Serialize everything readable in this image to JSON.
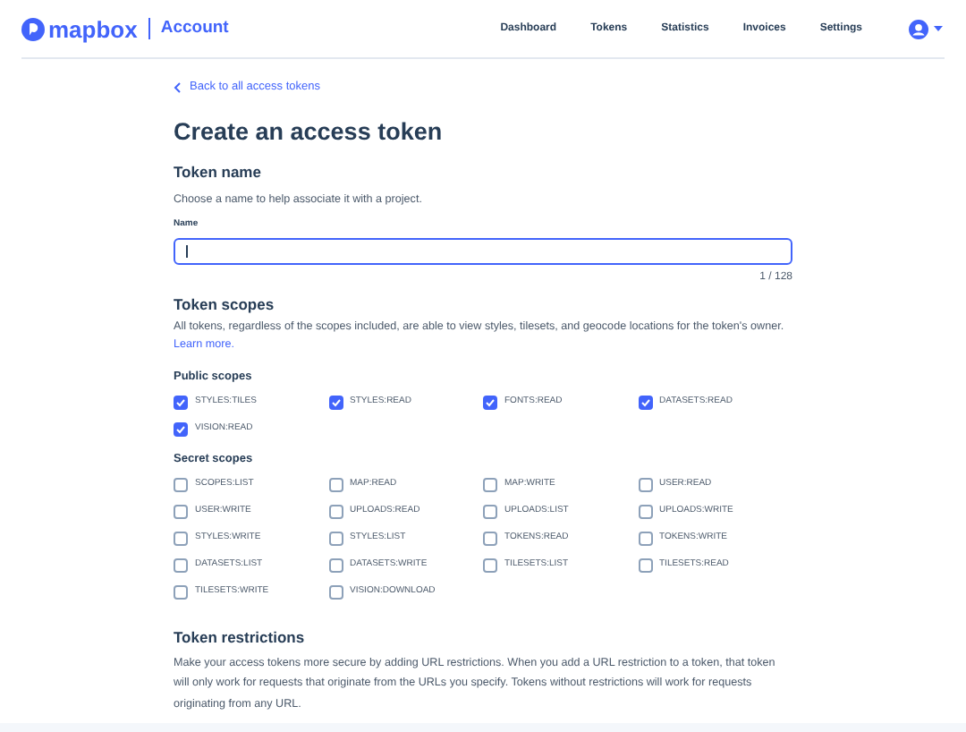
{
  "header": {
    "brand": "mapbox",
    "section": "Account",
    "nav": [
      "Dashboard",
      "Tokens",
      "Statistics",
      "Invoices",
      "Settings"
    ]
  },
  "back_link": "Back to all access tokens",
  "title": "Create an access token",
  "token_name": {
    "heading": "Token name",
    "description": "Choose a name to help associate it with a project.",
    "field_label": "Name",
    "counter": "1 / 128"
  },
  "token_scopes": {
    "heading": "Token scopes",
    "description": "All tokens, regardless of the scopes included, are able to view styles, tilesets, and geocode locations for the token's owner.",
    "link": "Learn more.",
    "groups": [
      {
        "heading": "Public scopes",
        "scopes": [
          {
            "label": "STYLES:TILES",
            "checked": true
          },
          {
            "label": "STYLES:READ",
            "checked": true
          },
          {
            "label": "FONTS:READ",
            "checked": true
          },
          {
            "label": "DATASETS:READ",
            "checked": true
          },
          {
            "label": "VISION:READ",
            "checked": true
          }
        ]
      },
      {
        "heading": "Secret scopes",
        "scopes": [
          {
            "label": "SCOPES:LIST",
            "checked": false
          },
          {
            "label": "MAP:READ",
            "checked": false
          },
          {
            "label": "MAP:WRITE",
            "checked": false
          },
          {
            "label": "USER:READ",
            "checked": false
          },
          {
            "label": "USER:WRITE",
            "checked": false
          },
          {
            "label": "UPLOADS:READ",
            "checked": false
          },
          {
            "label": "UPLOADS:LIST",
            "checked": false
          },
          {
            "label": "UPLOADS:WRITE",
            "checked": false
          },
          {
            "label": "STYLES:WRITE",
            "checked": false
          },
          {
            "label": "STYLES:LIST",
            "checked": false
          },
          {
            "label": "TOKENS:READ",
            "checked": false
          },
          {
            "label": "TOKENS:WRITE",
            "checked": false
          },
          {
            "label": "DATASETS:LIST",
            "checked": false
          },
          {
            "label": "DATASETS:WRITE",
            "checked": false
          },
          {
            "label": "TILESETS:LIST",
            "checked": false
          },
          {
            "label": "TILESETS:READ",
            "checked": false
          },
          {
            "label": "TILESETS:WRITE",
            "checked": false
          },
          {
            "label": "VISION:DOWNLOAD",
            "checked": false
          }
        ]
      }
    ]
  },
  "token_restrictions": {
    "heading": "Token restrictions",
    "description": "Make your access tokens more secure by adding URL restrictions. When you add a URL restriction to a token, that token will only work for requests that originate from the URLs you specify. Tokens without restrictions will work for requests originating from any URL."
  }
}
